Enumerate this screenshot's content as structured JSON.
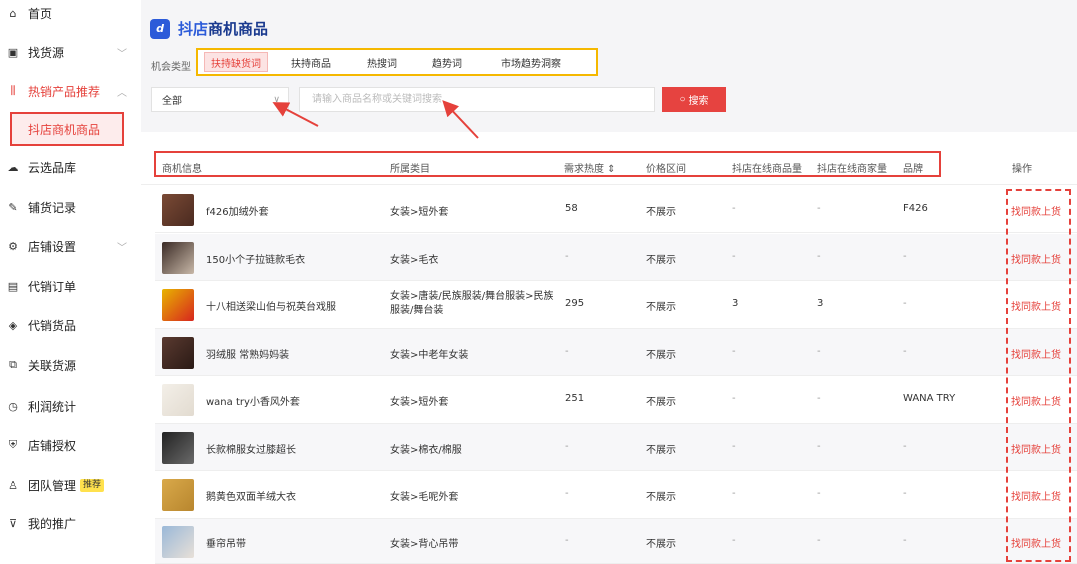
{
  "sidebar": {
    "items": [
      {
        "label": "首页",
        "icon": "home-icon",
        "glyph": "⌂"
      },
      {
        "label": "找货源",
        "icon": "find-source-icon",
        "glyph": "▣"
      },
      {
        "label": "热销产品推荐",
        "icon": "hot-products-icon",
        "glyph": "⫼"
      },
      {
        "label": "云选品库",
        "icon": "cloud-icon",
        "glyph": "☁"
      },
      {
        "label": "铺货记录",
        "icon": "record-icon",
        "glyph": "✎"
      },
      {
        "label": "店铺设置",
        "icon": "store-settings-icon",
        "glyph": "⚙"
      },
      {
        "label": "代销订单",
        "icon": "order-icon",
        "glyph": "▤"
      },
      {
        "label": "代销货品",
        "icon": "goods-icon",
        "glyph": "◈"
      },
      {
        "label": "关联货源",
        "icon": "link-icon",
        "glyph": "⧉"
      },
      {
        "label": "利润统计",
        "icon": "clock-icon",
        "glyph": "◷"
      },
      {
        "label": "店铺授权",
        "icon": "shield-icon",
        "glyph": "⛨"
      },
      {
        "label": "团队管理",
        "icon": "team-icon",
        "glyph": "♙",
        "badge": "推荐"
      },
      {
        "label": "我的推广",
        "icon": "promotion-icon",
        "glyph": "⊽"
      }
    ],
    "sub_active": "抖店商机商品"
  },
  "header": {
    "logo_letter": "d",
    "title_prefix": "抖店",
    "title_suffix": "商机商品"
  },
  "tabs": {
    "label": "机会类型",
    "items": [
      "扶持缺货词",
      "扶持商品",
      "热搜词",
      "趋势词",
      "市场趋势洞察"
    ]
  },
  "filters": {
    "category_value": "全部",
    "search_placeholder": "请输入商品名称或关键词搜索",
    "search_button": "搜索"
  },
  "table": {
    "columns": [
      "商机信息",
      "所属类目",
      "需求热度 ⇕",
      "价格区间",
      "抖店在线商品量",
      "抖店在线商家量",
      "品牌",
      "操作"
    ],
    "rows": [
      {
        "name": "f426加绒外套",
        "category": "女装>短外套",
        "heat": "58",
        "price": "不展示",
        "goods": "-",
        "merchants": "-",
        "brand": "F426",
        "op": "找同款上货",
        "thumb": [
          "#7a4a35",
          "#4a2a20"
        ]
      },
      {
        "name": "150小个子拉链款毛衣",
        "category": "女装>毛衣",
        "heat": "-",
        "price": "不展示",
        "goods": "-",
        "merchants": "-",
        "brand": "-",
        "op": "找同款上货",
        "thumb": [
          "#3a2a25",
          "#c8b8a8"
        ]
      },
      {
        "name": "十八相送梁山伯与祝英台戏服",
        "category": "女装>唐装/民族服装/舞台服装>民族服装/舞台装",
        "heat": "295",
        "price": "不展示",
        "goods": "3",
        "merchants": "3",
        "brand": "-",
        "op": "找同款上货",
        "thumb": [
          "#e8b400",
          "#d7261e"
        ]
      },
      {
        "name": "羽绒服 常熟妈妈装",
        "category": "女装>中老年女装",
        "heat": "-",
        "price": "不展示",
        "goods": "-",
        "merchants": "-",
        "brand": "-",
        "op": "找同款上货",
        "thumb": [
          "#5a3a30",
          "#2a1a15"
        ]
      },
      {
        "name": "wana try小香风外套",
        "category": "女装>短外套",
        "heat": "251",
        "price": "不展示",
        "goods": "-",
        "merchants": "-",
        "brand": "WANA TRY",
        "op": "找同款上货",
        "thumb": [
          "#f3efe8",
          "#e2dbd0"
        ]
      },
      {
        "name": "长款棉服女过膝超长",
        "category": "女装>棉衣/棉服",
        "heat": "-",
        "price": "不展示",
        "goods": "-",
        "merchants": "-",
        "brand": "-",
        "op": "找同款上货",
        "thumb": [
          "#222222",
          "#6a6a6a"
        ]
      },
      {
        "name": "鹅黄色双面羊绒大衣",
        "category": "女装>毛呢外套",
        "heat": "-",
        "price": "不展示",
        "goods": "-",
        "merchants": "-",
        "brand": "-",
        "op": "找同款上货",
        "thumb": [
          "#d9a94a",
          "#b8862e"
        ]
      },
      {
        "name": "垂帘吊带",
        "category": "女装>背心吊带",
        "heat": "-",
        "price": "不展示",
        "goods": "-",
        "merchants": "-",
        "brand": "-",
        "op": "找同款上货",
        "thumb": [
          "#9ab8d8",
          "#e8e0d8"
        ]
      }
    ]
  },
  "colors": {
    "accent": "#e5413b",
    "brand": "#2c5bd9",
    "highlight_box": "#f5b800"
  }
}
